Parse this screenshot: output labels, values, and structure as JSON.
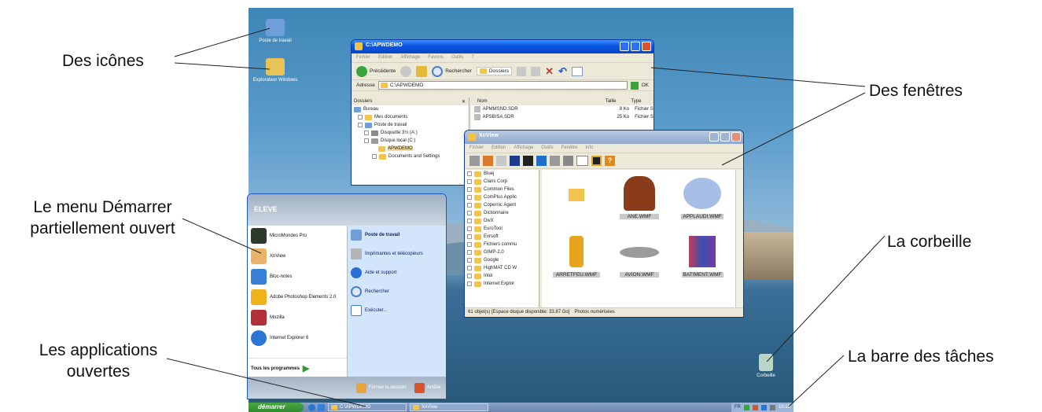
{
  "callouts": {
    "icons": "Des icônes",
    "windows": "Des fenêtres",
    "start_menu_line1": "Le menu Démarrer",
    "start_menu_line2": "partiellement ouvert",
    "recycle_bin": "La corbeille",
    "open_apps_line1": "Les applications",
    "open_apps_line2": "ouvertes",
    "taskbar": "La barre des tâches"
  },
  "desktop": {
    "icons": [
      {
        "label": "Poste de travail",
        "icon": "computer-icon"
      },
      {
        "label": "Explorateur Windows",
        "icon": "explorer-icon"
      },
      {
        "label": "Corbeille",
        "icon": "recycle-bin-icon"
      }
    ]
  },
  "explorer_window": {
    "title": "C:\\APWDEMO",
    "menu": [
      "Fichier",
      "Edition",
      "Affichage",
      "Favoris",
      "Outils",
      "?"
    ],
    "toolbar": {
      "back": "Précédente",
      "search": "Rechercher",
      "folders": "Dossiers"
    },
    "address_label": "Adresse",
    "address_value": "C:\\APWDEMO",
    "go_label": "OK",
    "tree_header": "Dossiers",
    "tree": [
      "Bureau",
      "Mes documents",
      "Poste de travail",
      "Disquette 3½ (A:)",
      "Disque local (C:)",
      "APWDEMO",
      "Documents and Settings"
    ],
    "columns": {
      "name": "Nom",
      "size": "Taille",
      "type": "Type"
    },
    "files": [
      {
        "name": "APMMSND.SDR",
        "size": "8 Ko",
        "type": "Fichier S"
      },
      {
        "name": "APSBISA.SDR",
        "size": "25 Ko",
        "type": "Fichier S"
      }
    ]
  },
  "xnview_window": {
    "title": "XnView",
    "menu": [
      "Fichier",
      "Edition",
      "Affichage",
      "Outils",
      "Fenêtre",
      "Info"
    ],
    "tree": [
      "Bluej",
      "Claris Corp",
      "Common Files",
      "ComPlus Applic",
      "Copernic Agent",
      "Dictionnaire",
      "DivX",
      "EuroTool",
      "Evrsoft",
      "Fichiers commu",
      "GIMP-2.0",
      "Google",
      "HighMAT CD W",
      "Intel",
      "Internet Explor"
    ],
    "thumbnails": [
      {
        "label": "",
        "icon": "folder-icon"
      },
      {
        "label": "ANE.WMF",
        "icon": "donkey-icon"
      },
      {
        "label": "APPLAUDI.WMF",
        "icon": "applause-icon"
      },
      {
        "label": "ARRETFEU.WMF",
        "icon": "traffic-light-icon"
      },
      {
        "label": "AVION.WMF",
        "icon": "airplane-icon"
      },
      {
        "label": "BATIMENT.WMF",
        "icon": "building-icon"
      }
    ],
    "status": "61 objet(s) [Espace disque disponible: 33.87 Go]",
    "status_right": "Photos numérisées"
  },
  "start_menu": {
    "user": "ELEVE",
    "left_items": [
      {
        "label": "MicroMondes Pro",
        "color": "#2e3a2c"
      },
      {
        "label": "XnView",
        "color": "#e9b36a"
      },
      {
        "label": "Bloc-notes",
        "color": "#3a7fd6"
      },
      {
        "label": "Adobe Photoshop Elements 2.0",
        "color": "#f0b21c"
      },
      {
        "label": "Mozilla",
        "color": "#b3303a"
      },
      {
        "label": "Internet Explorer 6",
        "color": "#2a76d2"
      }
    ],
    "all_programs": "Tous les programmes",
    "right_items": [
      {
        "label": "Poste de travail",
        "bold": true
      },
      {
        "label": "Imprimantes et télécopieurs"
      },
      {
        "label": "Aide et support"
      },
      {
        "label": "Rechercher"
      },
      {
        "label": "Exécuter..."
      }
    ],
    "logoff": "Fermer la session",
    "shutdown": "Arrêter"
  },
  "taskbar": {
    "start": "démarrer",
    "tasks": [
      "C:\\APWDEMO",
      "XnView"
    ],
    "lang": "FR",
    "clock": "10:15"
  },
  "colors": {
    "xp_blue": "#0a58e3",
    "start_green": "#3a9a35"
  }
}
